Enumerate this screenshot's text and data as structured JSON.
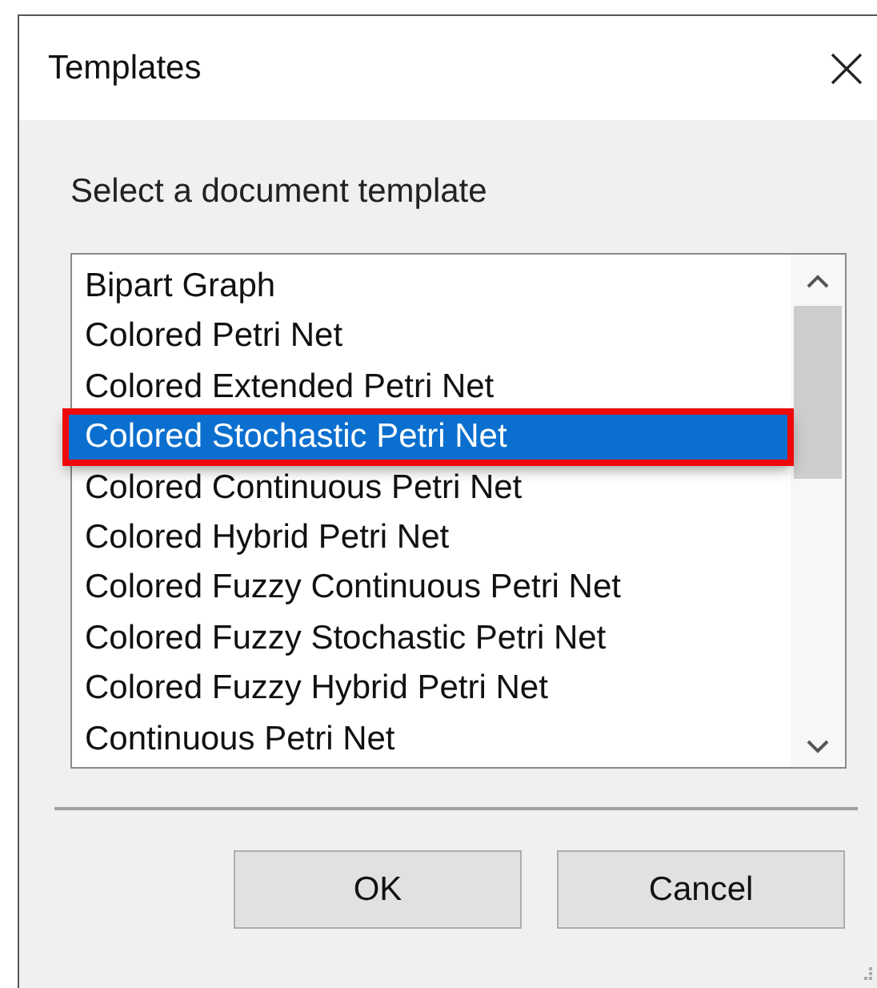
{
  "window": {
    "title": "Templates"
  },
  "prompt": "Select a document template",
  "templates": [
    {
      "label": "Bipart Graph",
      "selected": false,
      "highlighted": false
    },
    {
      "label": "Colored Petri Net",
      "selected": false,
      "highlighted": false
    },
    {
      "label": "Colored Extended Petri Net",
      "selected": false,
      "highlighted": false
    },
    {
      "label": "Colored Stochastic Petri Net",
      "selected": true,
      "highlighted": true
    },
    {
      "label": "Colored Continuous Petri Net",
      "selected": false,
      "highlighted": false
    },
    {
      "label": "Colored Hybrid Petri Net",
      "selected": false,
      "highlighted": false
    },
    {
      "label": "Colored Fuzzy Continuous Petri Net",
      "selected": false,
      "highlighted": false
    },
    {
      "label": "Colored Fuzzy Stochastic Petri Net",
      "selected": false,
      "highlighted": false
    },
    {
      "label": "Colored Fuzzy Hybrid Petri Net",
      "selected": false,
      "highlighted": false
    },
    {
      "label": "Continuous Petri Net",
      "selected": false,
      "highlighted": false
    }
  ],
  "buttons": [
    "OK",
    "Cancel"
  ]
}
